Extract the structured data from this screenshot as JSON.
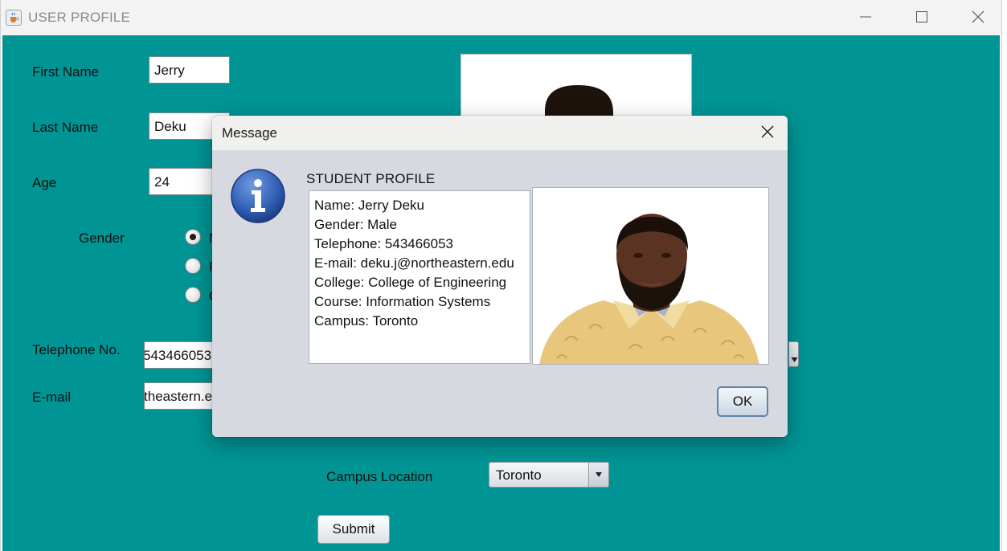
{
  "window": {
    "title": "USER PROFILE"
  },
  "form": {
    "first_name_label": "First Name",
    "first_name_value": "Jerry",
    "last_name_label": "Last Name",
    "last_name_value": "Deku",
    "age_label": "Age",
    "age_value": "24",
    "gender_label": "Gender",
    "gender_options": [
      "M",
      "F",
      "O"
    ],
    "gender_selected": "Male",
    "telephone_label": "Telephone No.",
    "telephone_value": "543466053",
    "email_label": "E-mail",
    "email_value": "deku.j@northeastern.edu",
    "campus_label": "Campus Location",
    "campus_value": "Toronto",
    "submit_label": "Submit"
  },
  "dialog": {
    "title": "Message",
    "heading": "STUDENT PROFILE",
    "lines": [
      "Name: Jerry Deku",
      "Gender: Male",
      "Telephone: 543466053",
      "E-mail: deku.j@northeastern.edu",
      "College: College of Engineering",
      "Course: Information Systems",
      "Campus: Toronto"
    ],
    "ok_label": "OK"
  },
  "icons": {
    "app": "java-cup-icon",
    "info": "information-icon",
    "close": "close-icon",
    "minimize": "minimize-icon",
    "maximize": "maximize-icon",
    "dropdown": "chevron-down-icon"
  },
  "colors": {
    "background": "#009494",
    "dialog_body": "#d6d9e0",
    "info_icon": "#2f5db3"
  }
}
